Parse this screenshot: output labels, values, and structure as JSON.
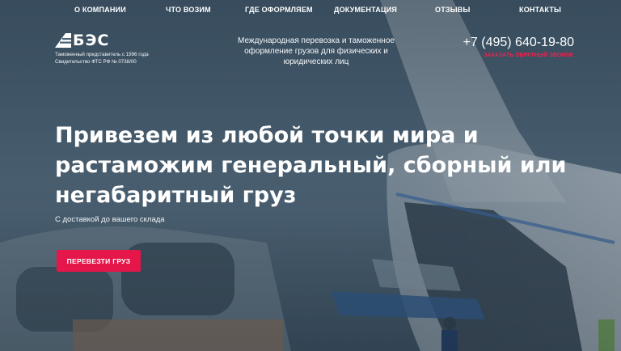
{
  "nav": {
    "items": [
      {
        "label": "О КОМПАНИИ"
      },
      {
        "label": "ЧТО ВОЗИМ"
      },
      {
        "label": "ГДЕ ОФОРМЛЯЕМ"
      },
      {
        "label": "ДОКУМЕНТАЦИЯ"
      },
      {
        "label": "ОТЗЫВЫ"
      },
      {
        "label": "КОНТАКТЫ"
      }
    ]
  },
  "header": {
    "logo_text": "БЭС",
    "logo_line1": "Таможенный представитель с 1996 года",
    "logo_line2": "Свидетельство ФТС РФ № 0738/00",
    "tagline": "Международная перевозка и таможенное оформление грузов для физических и юридических лиц",
    "phone": "+7 (495) 640-19-80",
    "callback": "ЗАКАЗАТЬ ОБРАТНЫЙ ЗВОНОК"
  },
  "hero": {
    "title": "Привезем из любой точки мира и растаможим генеральный, сборный или негабаритный груз",
    "subtitle": "С доставкой до вашего склада",
    "cta": "ПЕРЕВЕЗТИ ГРУЗ"
  },
  "colors": {
    "accent": "#e5174a",
    "callback": "#e8244f",
    "background": "#3f5566"
  },
  "icons": {
    "logo": "bes-logo-icon"
  }
}
